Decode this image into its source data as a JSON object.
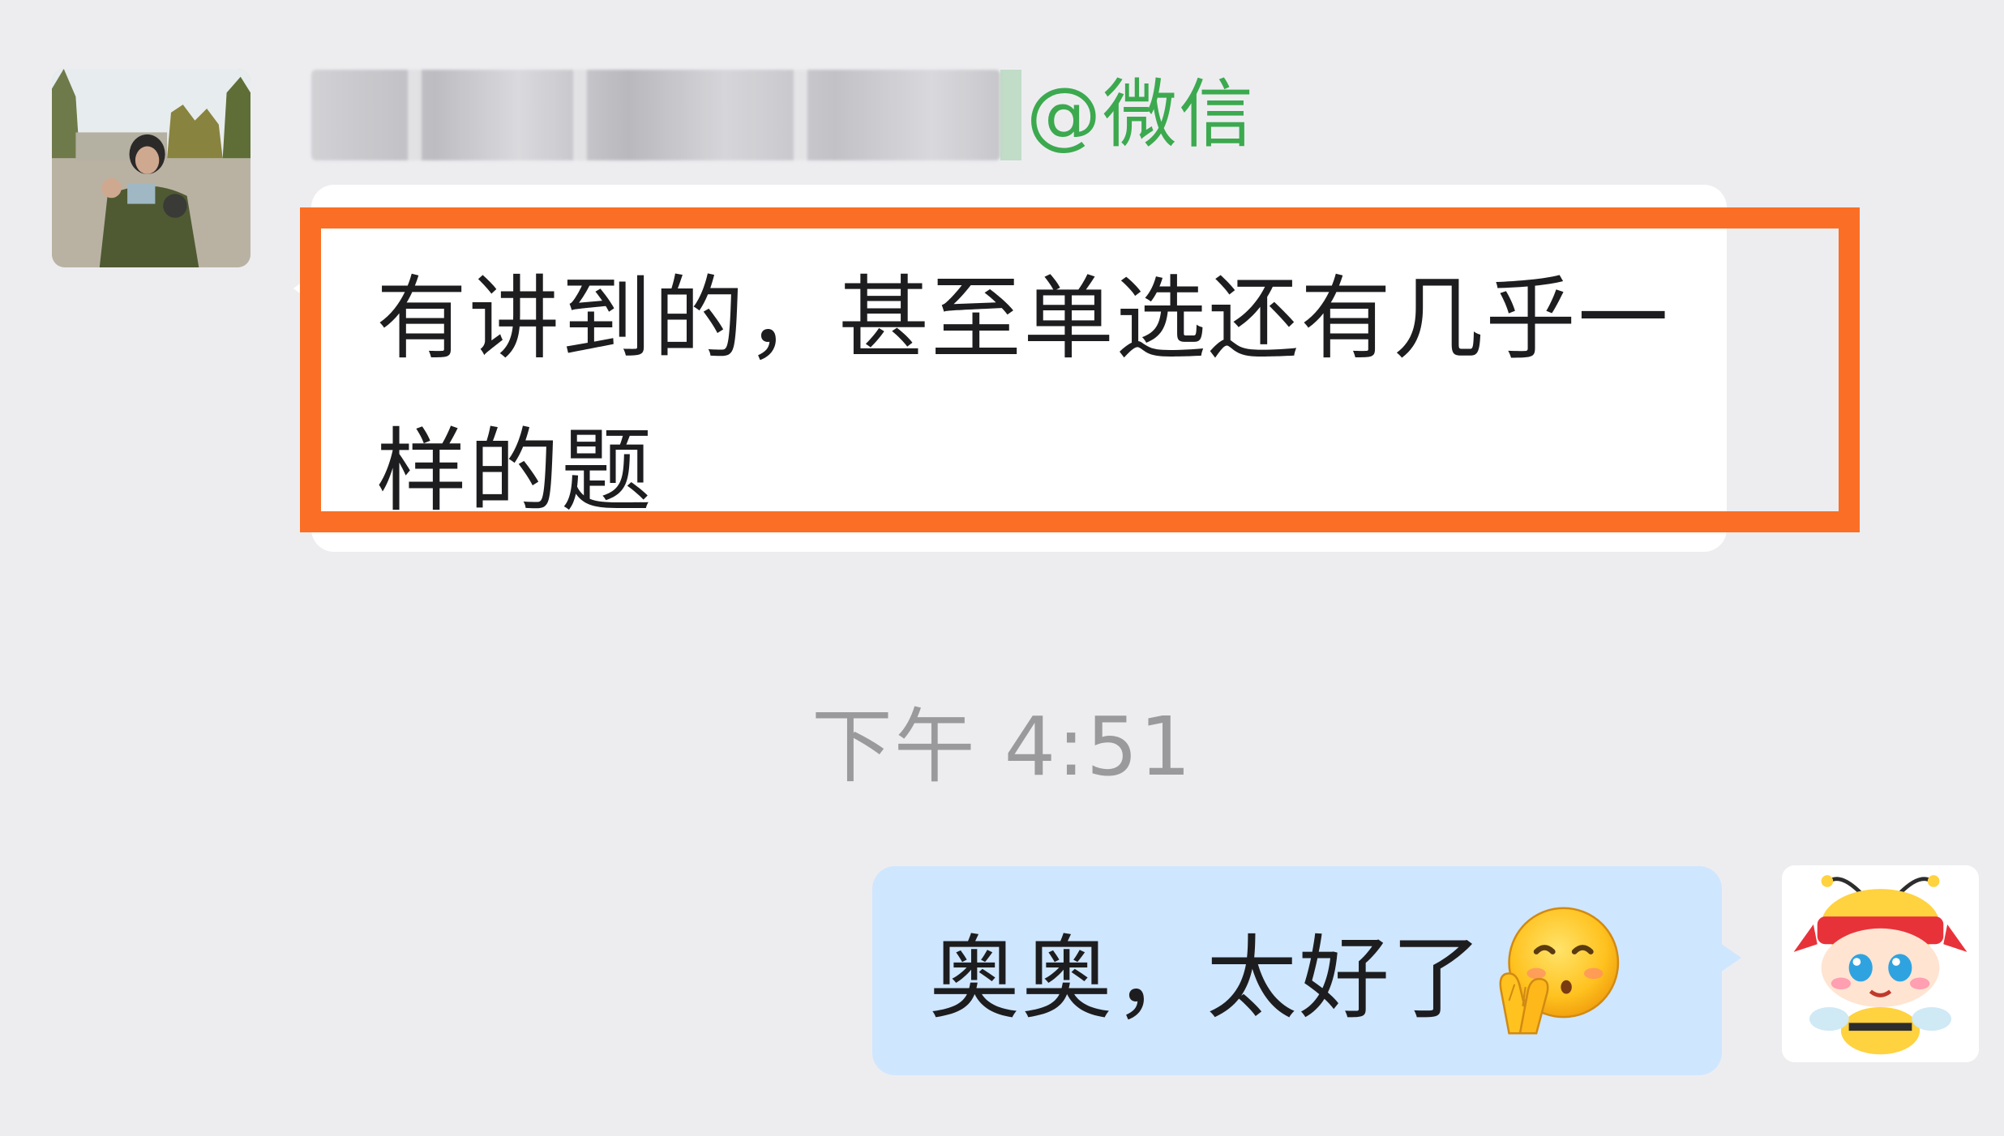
{
  "messages": {
    "incoming": {
      "sender_suffix": "@微信",
      "text": "有讲到的，甚至单选还有几乎一样的题"
    },
    "timestamp": "下午 4:51",
    "outgoing": {
      "text": "奥奥，太好了",
      "emoji": "praying-hands-smile-icon"
    }
  },
  "colors": {
    "background": "#ededf0",
    "incoming_bubble": "#ffffff",
    "outgoing_bubble": "#cfe6ff",
    "highlight": "#fa6f25",
    "sender_suffix": "#3ca94f",
    "timestamp": "#9a9a9d"
  }
}
